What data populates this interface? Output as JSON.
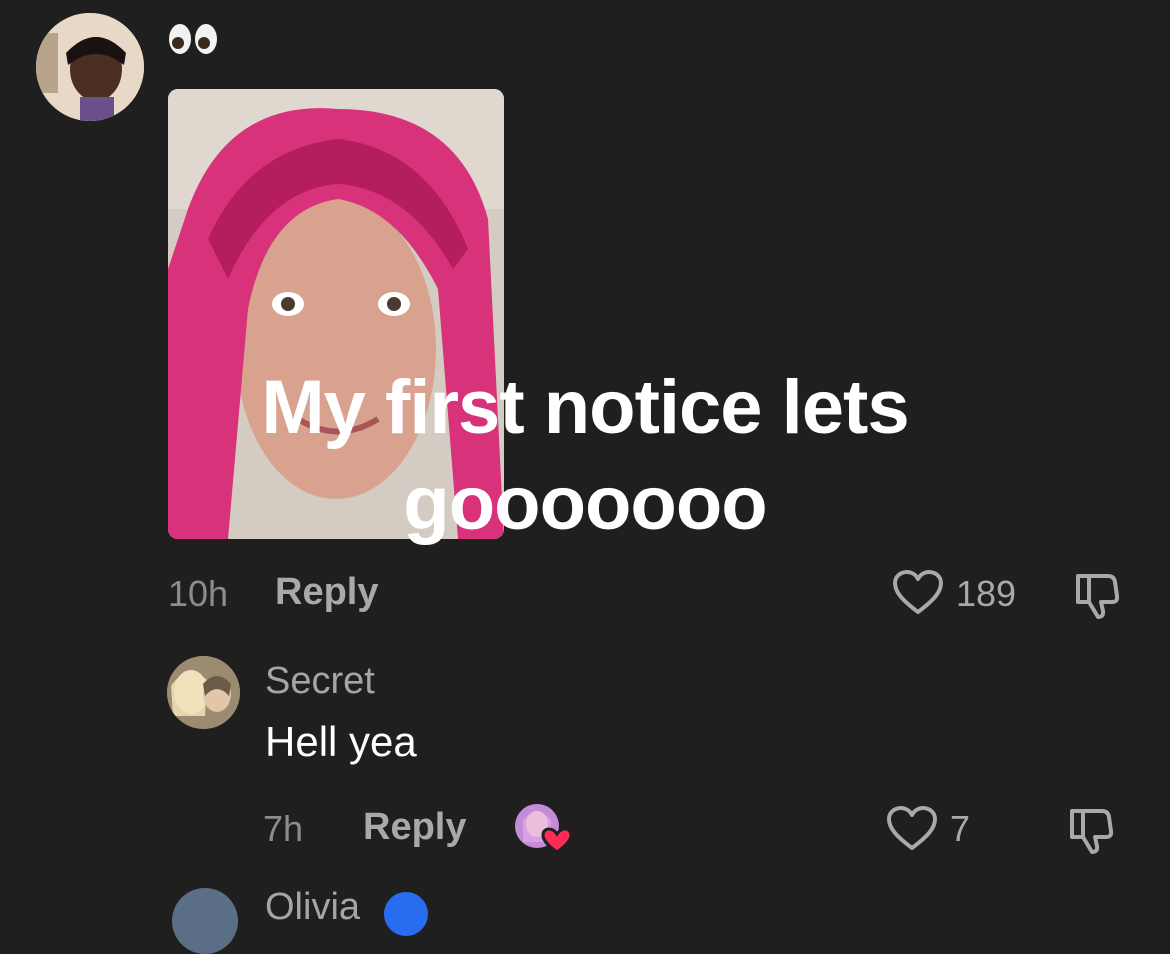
{
  "comment": {
    "emoji_text": "👀",
    "overlay_text": "My first notice lets gooooooo",
    "time": "10h",
    "reply_label": "Reply",
    "likes": "189",
    "avatar_icon": "user-avatar-icon"
  },
  "reply": {
    "username": "Secret",
    "text": "Hell yea",
    "time": "7h",
    "reply_label": "Reply",
    "likes": "7",
    "liked_by_creator": true
  },
  "next_comment": {
    "username": "Olivia"
  },
  "colors": {
    "background": "#1f1f1f",
    "meta_text": "#8c8c8c",
    "heart_badge": "#fe2c55",
    "verified_badge": "#2a6cf0"
  }
}
